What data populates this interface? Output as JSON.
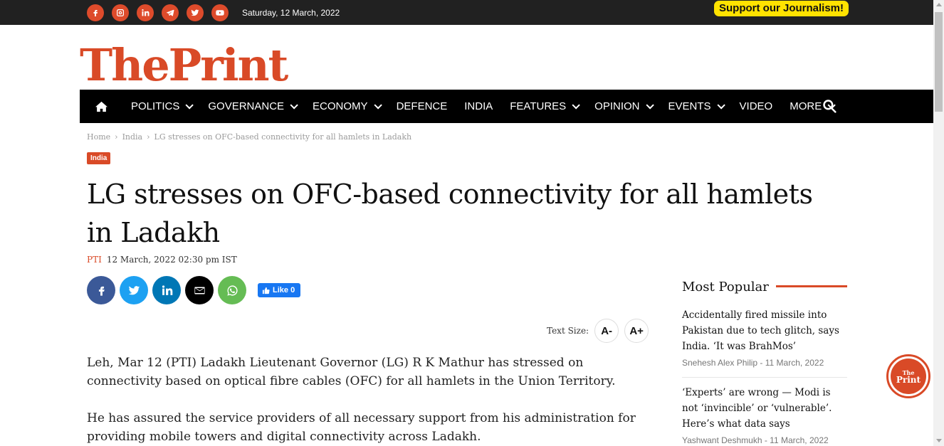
{
  "topbar": {
    "date": "Saturday, 12 March, 2022",
    "support": "Support our Journalism!",
    "social": [
      "facebook-icon",
      "instagram-icon",
      "linkedin-icon",
      "telegram-icon",
      "twitter-icon",
      "youtube-icon"
    ]
  },
  "logo": {
    "the": "The",
    "print": "Print"
  },
  "nav": {
    "items": [
      {
        "label": "POLITICS",
        "dropdown": true
      },
      {
        "label": "GOVERNANCE",
        "dropdown": true
      },
      {
        "label": "ECONOMY",
        "dropdown": true
      },
      {
        "label": "DEFENCE",
        "dropdown": false
      },
      {
        "label": "INDIA",
        "dropdown": false
      },
      {
        "label": "FEATURES",
        "dropdown": true
      },
      {
        "label": "OPINION",
        "dropdown": true
      },
      {
        "label": "EVENTS",
        "dropdown": true
      },
      {
        "label": "VIDEO",
        "dropdown": false
      },
      {
        "label": "MORE",
        "dropdown": true
      }
    ]
  },
  "breadcrumb": {
    "home": "Home",
    "section": "India",
    "current": "LG stresses on OFC-based connectivity for all hamlets in Ladakh",
    "sep": "›"
  },
  "article": {
    "category": "India",
    "headline": "LG stresses on OFC-based connectivity for all hamlets in Ladakh",
    "author": "PTI",
    "date": "12 March, 2022 02:30 pm IST",
    "fb_like": "Like 0",
    "text_size_label": "Text Size:",
    "text_minus": "A-",
    "text_plus": "A+",
    "paragraphs": [
      "Leh, Mar 12 (PTI) Ladakh Lieutenant Governor (LG) R K Mathur has stressed on connectivity based on optical fibre cables (OFC) for all hamlets in the Union Territory.",
      "He has assured the service providers of all necessary support from his administration for providing mobile towers and digital connectivity across Ladakh."
    ]
  },
  "sidebar": {
    "title": "Most Popular",
    "items": [
      {
        "title": "Accidentally fired missile into Pakistan due to tech glitch, says India. ‘It was BrahMos’",
        "author": "Snehesh Alex Philip",
        "date": "11 March, 2022"
      },
      {
        "title": "‘Experts’ are wrong — Modi is not ‘invincible’ or ‘vulnerable’. Here’s what data says",
        "author": "Yashwant Deshmukh",
        "date": "11 March, 2022"
      }
    ]
  },
  "float_logo": {
    "the": "The",
    "print": "Print"
  },
  "colors": {
    "brand": "#d94a27",
    "support": "#ffe200",
    "topbar": "#212121"
  }
}
